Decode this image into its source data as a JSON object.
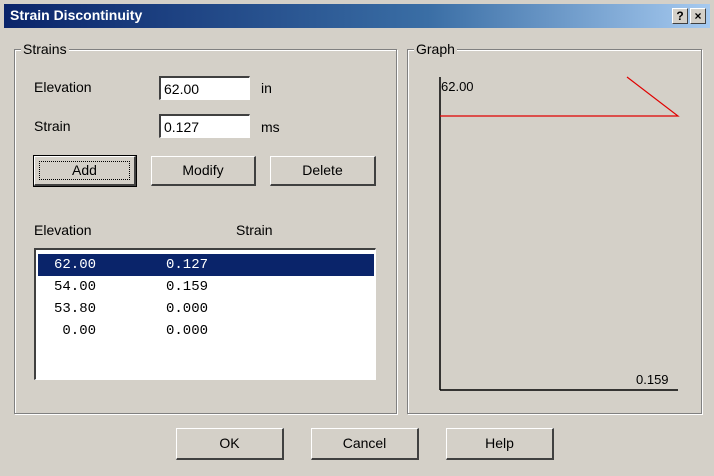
{
  "window": {
    "title": "Strain Discontinuity",
    "help_glyph": "?",
    "close_glyph": "×"
  },
  "strains": {
    "legend": "Strains",
    "elevation_label": "Elevation",
    "elevation_value": "62.00",
    "elevation_unit": "in",
    "strain_label": "Strain",
    "strain_value": "0.127",
    "strain_unit": "ms",
    "add_label": "Add",
    "modify_label": "Modify",
    "delete_label": "Delete",
    "col_elevation": "Elevation",
    "col_strain": "Strain",
    "rows": [
      {
        "elevation": "62.00",
        "strain": "0.127",
        "selected": true
      },
      {
        "elevation": "54.00",
        "strain": "0.159",
        "selected": false
      },
      {
        "elevation": "53.80",
        "strain": "0.000",
        "selected": false
      },
      {
        "elevation": "0.00",
        "strain": "0.000",
        "selected": false
      }
    ]
  },
  "graph": {
    "legend": "Graph",
    "top_label": "62.00",
    "bottom_right_label": "0.159",
    "line_color": "#e00000"
  },
  "footer": {
    "ok_label": "OK",
    "cancel_label": "Cancel",
    "help_label": "Help"
  }
}
